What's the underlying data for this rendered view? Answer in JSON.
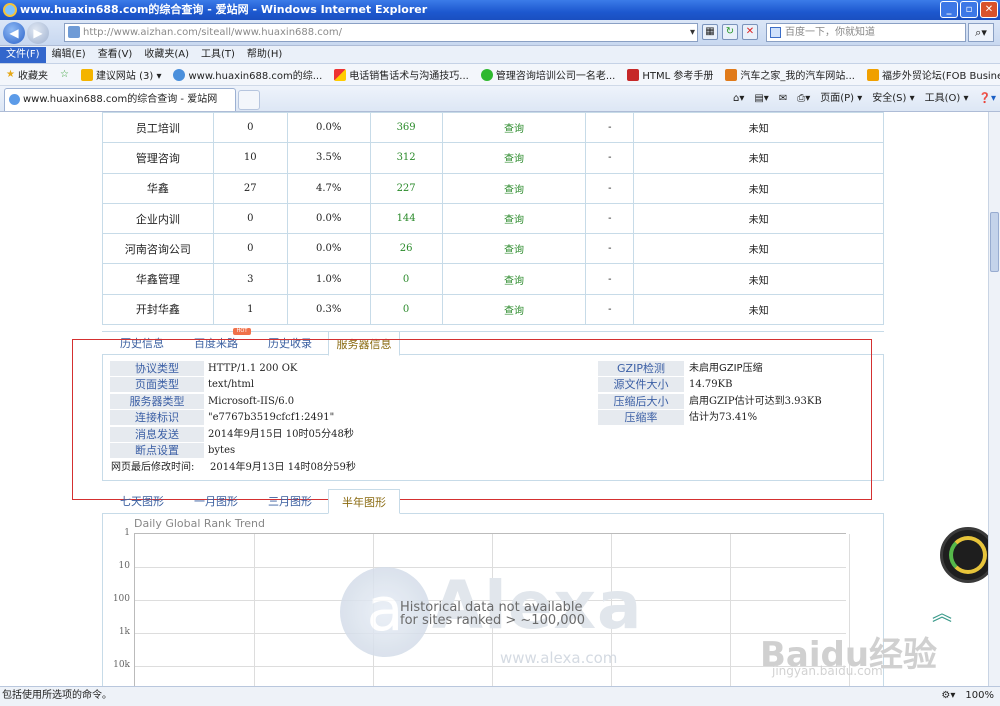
{
  "window": {
    "title": "www.huaxin688.com的综合查询 - 爱站网 - Windows Internet Explorer"
  },
  "addressbar": {
    "url": "http://www.aizhan.com/siteall/www.huaxin688.com/",
    "search_placeholder": "百度一下，你就知道"
  },
  "menu": [
    "文件(F)",
    "编辑(E)",
    "查看(V)",
    "收藏夹(A)",
    "工具(T)",
    "帮助(H)"
  ],
  "favorites": {
    "label": "收藏夹",
    "items": [
      "建议网站 (3) ▾",
      "www.huaxin688.com的综...",
      "电话销售话术与沟通技巧...",
      "管理咨询培训公司一名老...",
      "HTML 参考手册",
      "汽车之家_我的汽车网站...",
      "福步外贸论坛(FOB Busines..."
    ]
  },
  "tab": {
    "title": "www.huaxin688.com的综合查询 - 爱站网"
  },
  "commandbar": [
    "页面(P) ▾",
    "安全(S) ▾",
    "工具(O) ▾"
  ],
  "keywords": [
    {
      "name": "员工培训",
      "n1": "0",
      "pct": "0.0%",
      "idx": "369",
      "action": "查询",
      "dash": "-",
      "status": "未知"
    },
    {
      "name": "管理咨询",
      "n1": "10",
      "pct": "3.5%",
      "idx": "312",
      "action": "查询",
      "dash": "-",
      "status": "未知"
    },
    {
      "name": "华鑫",
      "n1": "27",
      "pct": "4.7%",
      "idx": "227",
      "action": "查询",
      "dash": "-",
      "status": "未知"
    },
    {
      "name": "企业内训",
      "n1": "0",
      "pct": "0.0%",
      "idx": "144",
      "action": "查询",
      "dash": "-",
      "status": "未知"
    },
    {
      "name": "河南咨询公司",
      "n1": "0",
      "pct": "0.0%",
      "idx": "26",
      "action": "查询",
      "dash": "-",
      "status": "未知"
    },
    {
      "name": "华鑫管理",
      "n1": "3",
      "pct": "1.0%",
      "idx": "0",
      "action": "查询",
      "dash": "-",
      "status": "未知"
    },
    {
      "name": "开封华鑫",
      "n1": "1",
      "pct": "0.3%",
      "idx": "0",
      "action": "查询",
      "dash": "-",
      "status": "未知"
    }
  ],
  "info_tabs": [
    "历史信息",
    "百度来路",
    "历史收录",
    "服务器信息"
  ],
  "server": {
    "protocol_label": "协议类型",
    "protocol": "HTTP/1.1 200 OK",
    "pagetype_label": "页面类型",
    "pagetype": "text/html",
    "servertype_label": "服务器类型",
    "servertype": "Microsoft-IIS/6.0",
    "etag_label": "连接标识",
    "etag": "\"e7767b3519cfcf1:2491\"",
    "date_label": "消息发送",
    "date": "2014年9月15日 10时05分48秒",
    "range_label": "断点设置",
    "range": "bytes",
    "modified_label": "网页最后修改时间:",
    "modified": "2014年9月13日 14时08分59秒",
    "gzip_label": "GZIP检测",
    "gzip": "未启用GZIP压缩",
    "size_label": "源文件大小",
    "size": "14.79KB",
    "compressed_label": "压缩后大小",
    "compressed": "启用GZIP估计可达到3.93KB",
    "ratio_label": "压缩率",
    "ratio": "估计为73.41%"
  },
  "chart_tabs": [
    "七天图形",
    "一月图形",
    "三月图形",
    "半年图形"
  ],
  "chart": {
    "title": "Daily Global Rank Trend",
    "yticks": [
      "1",
      "10",
      "100",
      "1k",
      "10k"
    ],
    "message1": "Historical data not available",
    "message2": "for sites ranked > ~100,000",
    "watermark": "Alexa",
    "watermark_url": "www.alexa.com"
  },
  "watermark": {
    "baidu": "Baidu经验",
    "baidu_url": "jingyan.baidu.com"
  },
  "status": {
    "text": "包括使用所选项的命令。",
    "zoom": "100%"
  }
}
